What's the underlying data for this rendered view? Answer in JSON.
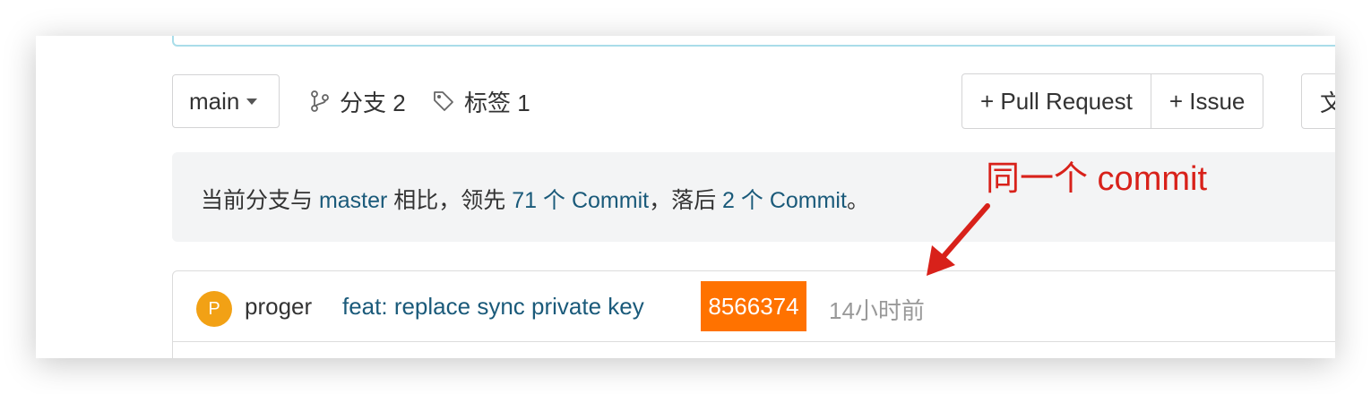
{
  "toolbar": {
    "branch_select": "main",
    "branches_label": "分支 2",
    "tags_label": "标签 1",
    "pull_request_label": "+ Pull Request",
    "issue_label": "+ Issue",
    "cut_button_label": "文"
  },
  "compare": {
    "prefix": "当前分支与 ",
    "base_branch": "master",
    "ahead_text": " 相比，领先 ",
    "ahead_link": "71 个 Commit",
    "behind_text": "，落后 ",
    "behind_link": "2 个 Commit",
    "suffix": "。"
  },
  "latest_commit": {
    "avatar_letter": "P",
    "author": "proger",
    "message": "feat: replace sync private key",
    "sha": "8566374",
    "time": "14小时前"
  },
  "annotation": {
    "text": "同一个 commit"
  },
  "colors": {
    "sha_highlight": "#ff7200",
    "annotation_red": "#d8211a",
    "link_blue": "#1a5a7a",
    "avatar_orange": "#f2a115"
  },
  "icons": {
    "branch": "git-branch-icon",
    "tag": "tag-icon",
    "caret": "caret-down-icon",
    "arrow": "annotation-arrow-icon"
  }
}
